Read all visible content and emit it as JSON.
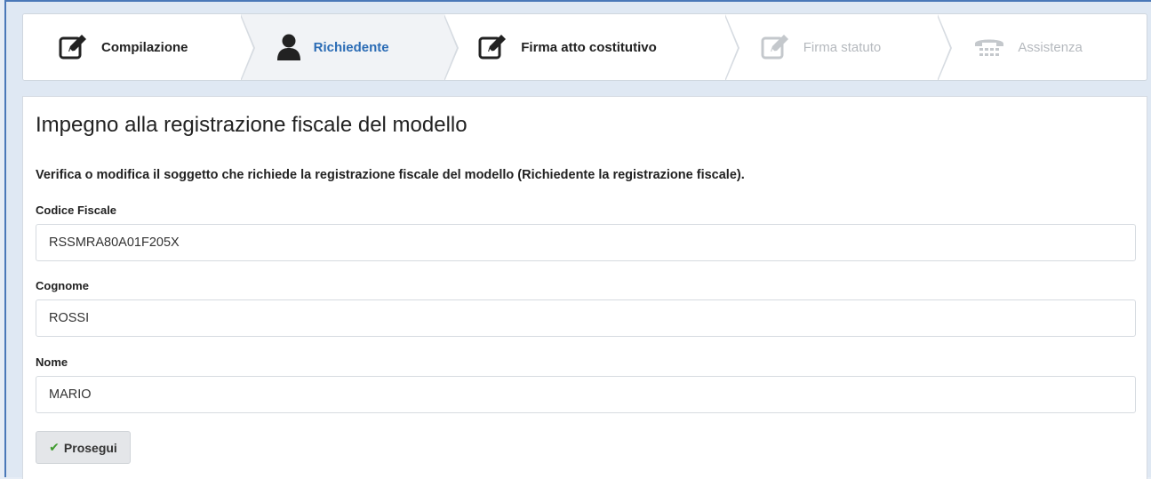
{
  "steps": [
    {
      "label": "Compilazione",
      "icon": "edit-icon",
      "state": "done"
    },
    {
      "label": "Richiedente",
      "icon": "user-icon",
      "state": "active"
    },
    {
      "label": "Firma atto costitutivo",
      "icon": "edit-icon",
      "state": "done"
    },
    {
      "label": "Firma statuto",
      "icon": "edit-icon",
      "state": "disabled"
    },
    {
      "label": "Assistenza",
      "icon": "phone-icon",
      "state": "disabled"
    }
  ],
  "form": {
    "title": "Impegno alla registrazione fiscale del modello",
    "description": "Verifica o modifica il soggetto che richiede la registrazione fiscale del modello (Richiedente la registrazione fiscale).",
    "fields": [
      {
        "label": "Codice Fiscale",
        "value": "RSSMRA80A01F205X"
      },
      {
        "label": "Cognome",
        "value": "ROSSI"
      },
      {
        "label": "Nome",
        "value": "MARIO"
      }
    ],
    "submit_label": "Prosegui"
  },
  "colors": {
    "accent": "#2b6cb5",
    "disabled": "#b5b9be",
    "check": "#3f9b2e"
  }
}
